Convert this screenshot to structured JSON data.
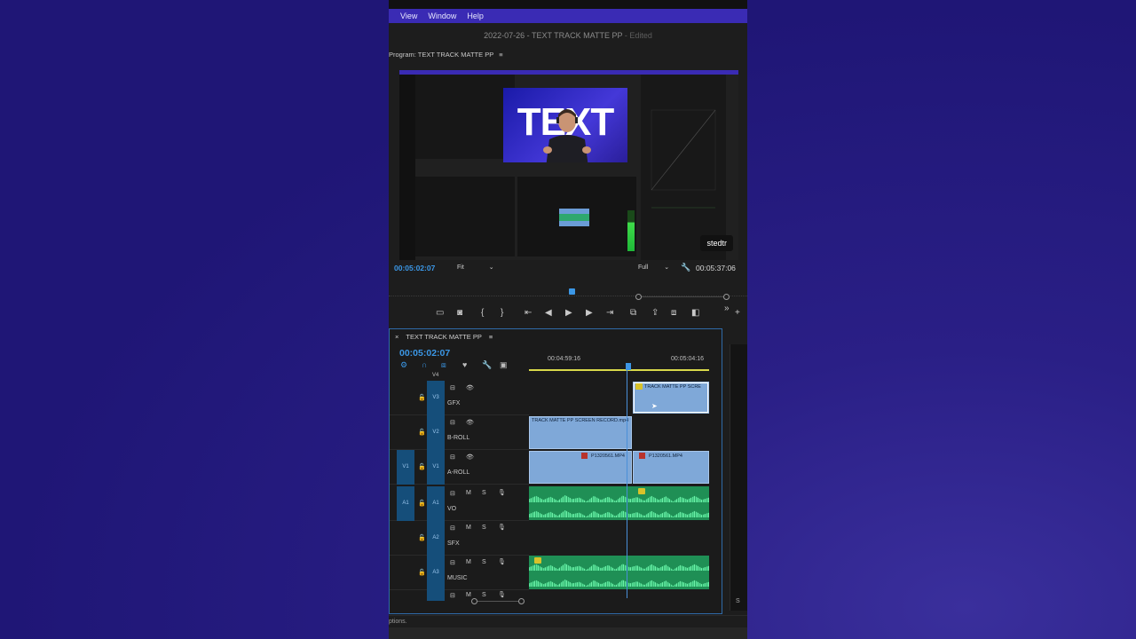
{
  "menu": {
    "items": [
      "View",
      "Window",
      "Help"
    ]
  },
  "document": {
    "title": "2022-07-26 - TEXT TRACK MATTE PP",
    "edited": " - Edited"
  },
  "program": {
    "panel_title": "Program: TEXT TRACK MATTE PP",
    "menu_glyph": "≡",
    "big_text": "TEXT",
    "watermark": "stedtr",
    "current_tc": "00:05:02:07",
    "fit": "Fit",
    "quality": "Full",
    "duration_tc": "00:05:37:06"
  },
  "sequence": {
    "tab_title": "TEXT TRACK MATTE PP",
    "close_glyph": "×",
    "menu_glyph": "≡",
    "timecode": "00:05:02:07",
    "ruler": {
      "left": "00:04:59:16",
      "right": "00:05:04:16"
    },
    "tracks": {
      "v4_label": "V4",
      "v3": {
        "tag": "V3",
        "name": "GFX"
      },
      "v2": {
        "tag": "V2",
        "name": "B-ROLL"
      },
      "v1": {
        "src": "V1",
        "tag": "V1",
        "name": "A-ROLL"
      },
      "a1": {
        "src": "A1",
        "tag": "A1",
        "name": "VO"
      },
      "a2": {
        "tag": "A2",
        "name": "SFX"
      },
      "a3": {
        "tag": "A3",
        "name": "MUSIC"
      },
      "mute": "M",
      "solo": "S"
    },
    "clips": {
      "gfx": "TRACK MATTE PP SCRE",
      "broll": "TRACK MATTE PP SCREEN RECORD.mp4",
      "aroll1": "P1320561.MP4",
      "aroll2": "P1320561.MP4"
    }
  },
  "side_label": "S",
  "status_text": "ptions.",
  "colors": {
    "accent": "#3b97e6",
    "menubar": "#3a2bb4",
    "video_clip": "#7fa8d8",
    "audio_clip": "#1f8f55"
  }
}
